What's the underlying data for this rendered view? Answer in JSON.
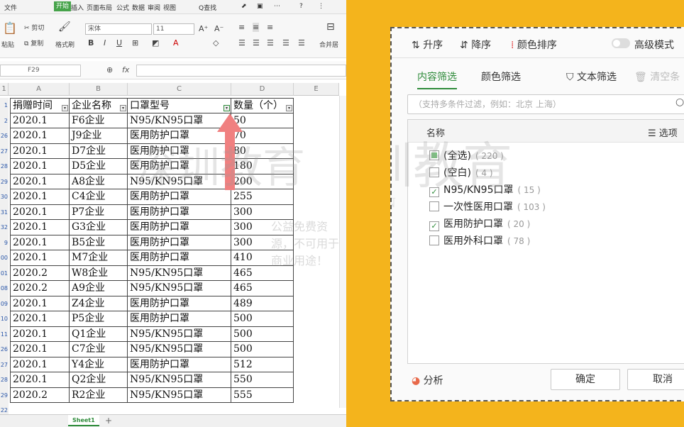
{
  "menubar": {
    "file": "文件",
    "start": "开始",
    "insert": "插入",
    "layout": "页面布局",
    "formula": "公式",
    "data": "数据",
    "review": "审阅",
    "view": "视图",
    "search": "Q查找"
  },
  "ribbon": {
    "cut": "剪切",
    "copy": "复制",
    "paste": "粘贴",
    "format_painter": "格式刷",
    "font_name": "宋体",
    "font_size": "11",
    "bold": "B",
    "italic": "I",
    "underline": "U",
    "merge": "合并居"
  },
  "formula_bar": {
    "name_box": "F29",
    "fx": "fx"
  },
  "columns": [
    "A",
    "B",
    "C",
    "D",
    "E"
  ],
  "table": {
    "headers": [
      "捐赠时间",
      "企业名称",
      "口罩型号",
      "数量（个）"
    ],
    "rows": [
      {
        "num": "2",
        "date": "2020.1",
        "company": "F6企业",
        "model": "N95/KN95口罩",
        "qty": "50"
      },
      {
        "num": "26",
        "date": "2020.1",
        "company": "J9企业",
        "model": "医用防护口罩",
        "qty": "70"
      },
      {
        "num": "27",
        "date": "2020.1",
        "company": "D7企业",
        "model": "医用防护口罩",
        "qty": "80"
      },
      {
        "num": "28",
        "date": "2020.1",
        "company": "D5企业",
        "model": "医用防护口罩",
        "qty": "180"
      },
      {
        "num": "29",
        "date": "2020.1",
        "company": "A8企业",
        "model": "N95/KN95口罩",
        "qty": "200"
      },
      {
        "num": "30",
        "date": "2020.1",
        "company": "C4企业",
        "model": "医用防护口罩",
        "qty": "255"
      },
      {
        "num": "31",
        "date": "2020.1",
        "company": "P7企业",
        "model": "医用防护口罩",
        "qty": "300"
      },
      {
        "num": "32",
        "date": "2020.1",
        "company": "G3企业",
        "model": "医用防护口罩",
        "qty": "300"
      },
      {
        "num": "9",
        "date": "2020.1",
        "company": "B5企业",
        "model": "医用防护口罩",
        "qty": "300"
      },
      {
        "num": "00",
        "date": "2020.1",
        "company": "M7企业",
        "model": "医用防护口罩",
        "qty": "410"
      },
      {
        "num": "01",
        "date": "2020.2",
        "company": "W8企业",
        "model": "N95/KN95口罩",
        "qty": "465"
      },
      {
        "num": "08",
        "date": "2020.2",
        "company": "A9企业",
        "model": "N95/KN95口罩",
        "qty": "465"
      },
      {
        "num": "09",
        "date": "2020.1",
        "company": "Z4企业",
        "model": "医用防护口罩",
        "qty": "489"
      },
      {
        "num": "10",
        "date": "2020.1",
        "company": "P5企业",
        "model": "医用防护口罩",
        "qty": "500"
      },
      {
        "num": "11",
        "date": "2020.1",
        "company": "Q1企业",
        "model": "N95/KN95口罩",
        "qty": "500"
      },
      {
        "num": "26",
        "date": "2020.1",
        "company": "C7企业",
        "model": "N95/KN95口罩",
        "qty": "500"
      },
      {
        "num": "27",
        "date": "2020.1",
        "company": "Y4企业",
        "model": "医用防护口罩",
        "qty": "512"
      },
      {
        "num": "28",
        "date": "2020.1",
        "company": "Q2企业",
        "model": "N95/KN95口罩",
        "qty": "550"
      },
      {
        "num": "29",
        "date": "2020.2",
        "company": "R2企业",
        "model": "N95/KN95口罩",
        "qty": "555"
      }
    ],
    "last_row_num": "22"
  },
  "sheet_tab": "Sheet1",
  "filter": {
    "sort_asc": "升序",
    "sort_desc": "降序",
    "sort_color": "颜色排序",
    "advanced_mode": "高级模式",
    "tab_content": "内容筛选",
    "tab_color": "颜色筛选",
    "text_filter": "文本筛选",
    "clear": "清空条",
    "search_placeholder": "（支持多条件过滤，例如：北京 上海）",
    "list_header": "名称",
    "options": "选项",
    "items": [
      {
        "label": "(全选)",
        "count": "( 220 )",
        "state": "partial"
      },
      {
        "label": "(空白)",
        "count": "( 4 )",
        "state": "unchecked"
      },
      {
        "label": "N95/KN95口罩",
        "count": "( 15 )",
        "state": "checked"
      },
      {
        "label": "一次性医用口罩",
        "count": "( 103 )",
        "state": "unchecked"
      },
      {
        "label": "医用防护口罩",
        "count": "( 20 )",
        "state": "checked"
      },
      {
        "label": "医用外科口罩",
        "count": "( 78 )",
        "state": "unchecked"
      }
    ],
    "analyze": "分析",
    "ok": "确定",
    "cancel": "取消"
  },
  "watermark": {
    "main": "深圳教育",
    "pinyin": "SHENZHEN",
    "slogan": "公益免费资源，不可用于商业用途！"
  },
  "colors": {
    "accent": "#2e8b3a",
    "arrow": "#f08080",
    "background": "#f4b41c"
  }
}
